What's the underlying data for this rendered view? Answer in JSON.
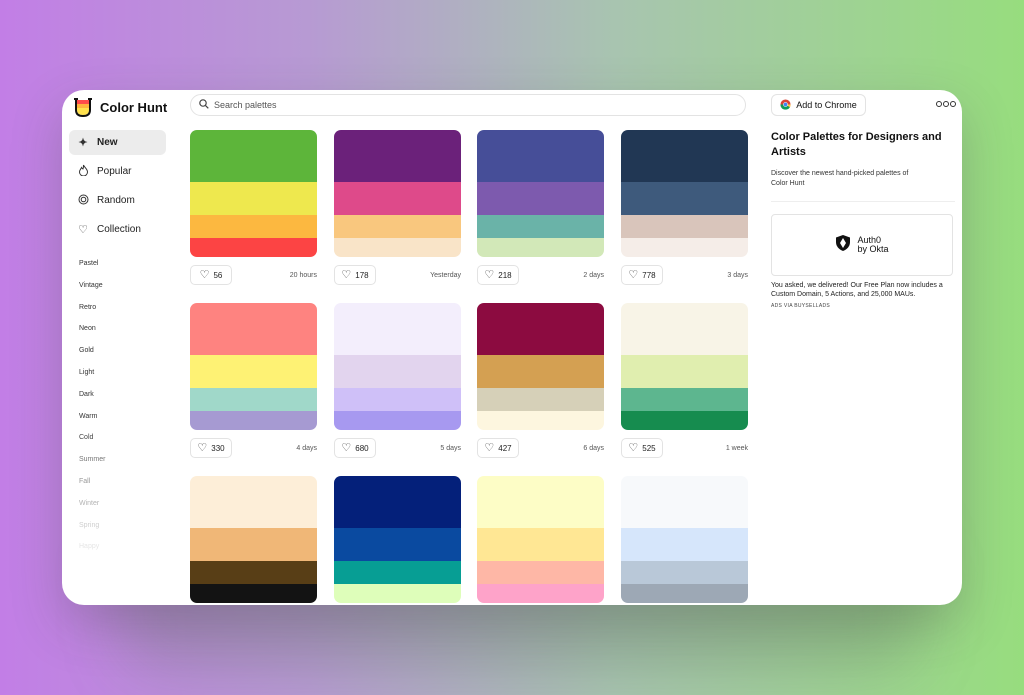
{
  "header": {
    "logo_text": "Color Hunt",
    "search_placeholder": "Search palettes",
    "chrome_button": "Add to Chrome"
  },
  "nav": [
    {
      "label": "New",
      "icon": "sparkle-icon"
    },
    {
      "label": "Popular",
      "icon": "flame-icon"
    },
    {
      "label": "Random",
      "icon": "spiral-icon"
    },
    {
      "label": "Collection",
      "icon": "heart-icon"
    }
  ],
  "tags": [
    "Pastel",
    "Vintage",
    "Retro",
    "Neon",
    "Gold",
    "Light",
    "Dark",
    "Warm",
    "Cold",
    "Summer",
    "Fall",
    "Winter",
    "Spring",
    "Happy"
  ],
  "palettes": [
    {
      "colors": [
        "#5db53a",
        "#eee84e",
        "#fcb840",
        "#fc4444"
      ],
      "likes": "56",
      "date": "20 hours"
    },
    {
      "colors": [
        "#6b217a",
        "#de4a8a",
        "#f9c77e",
        "#f9e4c8"
      ],
      "likes": "178",
      "date": "Yesterday"
    },
    {
      "colors": [
        "#464e98",
        "#7d5aae",
        "#6ab3a8",
        "#d2e8b8"
      ],
      "likes": "218",
      "date": "2 days"
    },
    {
      "colors": [
        "#213754",
        "#3e5a7c",
        "#d9c5bb",
        "#f5ede8"
      ],
      "likes": "778",
      "date": "3 days"
    },
    {
      "colors": [
        "#fe8380",
        "#fef274",
        "#a0d8c9",
        "#a69ad2"
      ],
      "likes": "330",
      "date": "4 days"
    },
    {
      "colors": [
        "#f3eefc",
        "#e2d4ee",
        "#cfc0f8",
        "#a799f0"
      ],
      "likes": "680",
      "date": "5 days"
    },
    {
      "colors": [
        "#8c0b40",
        "#d4a052",
        "#d6d0b8",
        "#fdf6df"
      ],
      "likes": "427",
      "date": "6 days"
    },
    {
      "colors": [
        "#f8f4e7",
        "#e0eeaf",
        "#5db68f",
        "#168c4f"
      ],
      "likes": "525",
      "date": "1 week"
    },
    {
      "colors": [
        "#fdeed8",
        "#f0b777",
        "#583e16",
        "#131313"
      ],
      "likes": "",
      "date": ""
    },
    {
      "colors": [
        "#04207a",
        "#0a4aa0",
        "#079e94",
        "#defeba"
      ],
      "likes": "",
      "date": ""
    },
    {
      "colors": [
        "#fdfdc6",
        "#ffe794",
        "#feb7a6",
        "#fea3c9"
      ],
      "likes": "",
      "date": ""
    },
    {
      "colors": [
        "#f7f9fb",
        "#d6e6fb",
        "#b9c8d8",
        "#9da8b5"
      ],
      "likes": "",
      "date": ""
    }
  ],
  "panel": {
    "title": "Color Palettes for Designers and Artists",
    "desc": "Discover the newest hand-picked palettes of Color Hunt",
    "ad_brand_line1": "Auth0",
    "ad_brand_line2": "by Okta",
    "ad_copy": "You asked, we delivered! Our Free Plan now includes a Custom Domain, 5 Actions, and 25,000 MAUs.",
    "ad_via": "ADS VIA BUYSELLADS"
  }
}
